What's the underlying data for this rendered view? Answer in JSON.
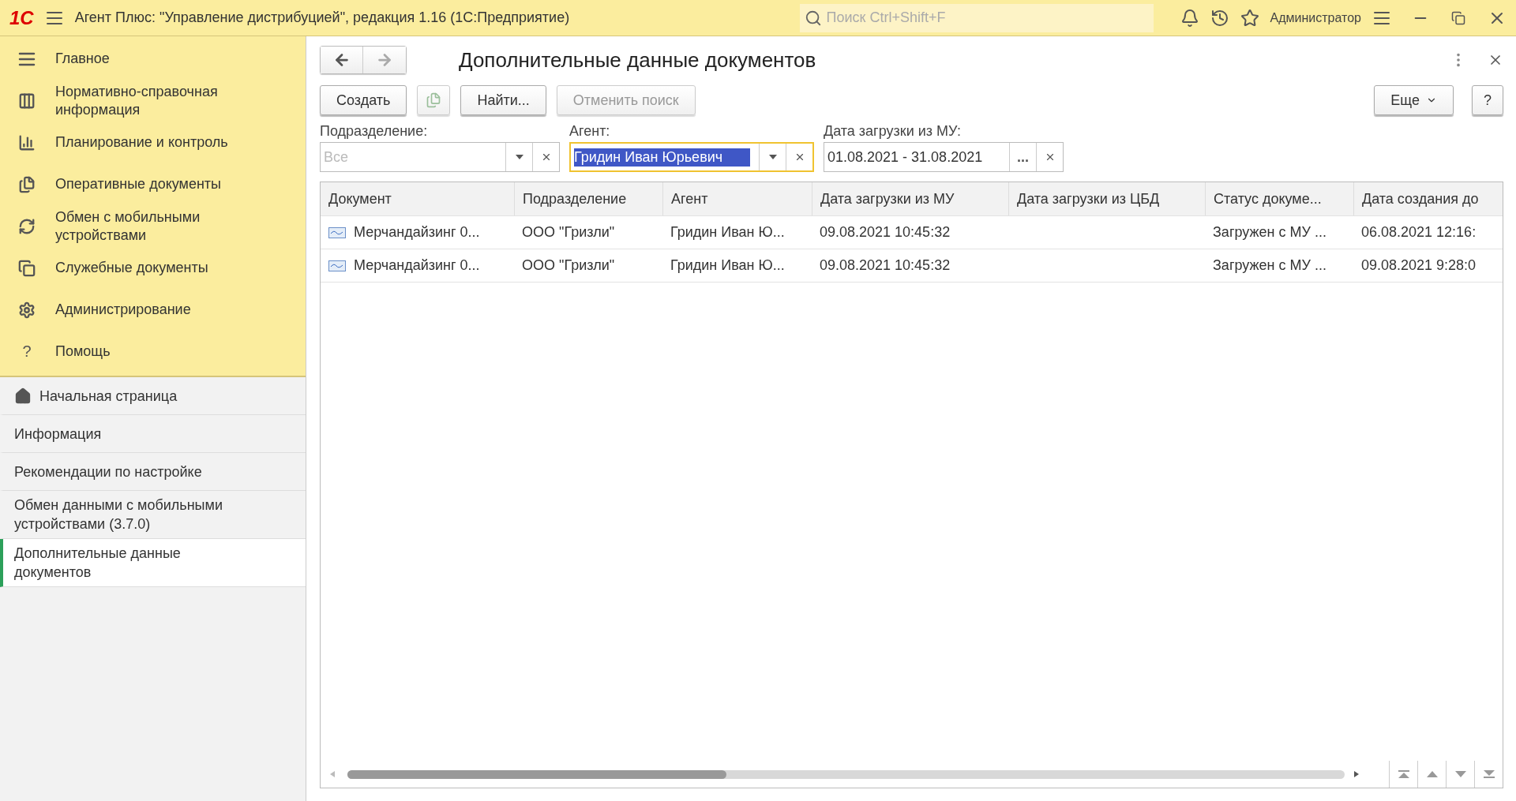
{
  "titlebar": {
    "logo": "1С",
    "title": "Агент Плюс: \"Управление дистрибуцией\", редакция 1.16  (1С:Предприятие)",
    "search_placeholder": "Поиск Ctrl+Shift+F",
    "user": "Администратор"
  },
  "sections": [
    {
      "label": "Главное"
    },
    {
      "label": "Нормативно-справочная информация"
    },
    {
      "label": "Планирование и контроль"
    },
    {
      "label": "Оперативные документы"
    },
    {
      "label": "Обмен с мобильными устройствами"
    },
    {
      "label": "Служебные документы"
    },
    {
      "label": "Администрирование"
    },
    {
      "label": "Помощь"
    }
  ],
  "help_glyph": "?",
  "open_pages": [
    {
      "label": "Начальная страница",
      "home": true,
      "selected": false
    },
    {
      "label": "Информация",
      "home": false,
      "selected": false
    },
    {
      "label": "Рекомендации по настройке",
      "home": false,
      "selected": false
    },
    {
      "label": "Обмен данными с мобильными устройствами (3.7.0)",
      "home": false,
      "selected": false
    },
    {
      "label": "Дополнительные данные документов",
      "home": false,
      "selected": true
    }
  ],
  "form": {
    "title": "Дополнительные данные документов",
    "buttons": [
      {
        "label": "Создать",
        "disabled": false
      },
      {
        "label": "Найти...",
        "disabled": false
      },
      {
        "label": "Отменить поиск",
        "disabled": true
      }
    ],
    "more": "Еще",
    "help": "?",
    "filters": [
      {
        "label": "Подразделение:",
        "placeholder": "Все",
        "kind": "select",
        "focused": false
      },
      {
        "label": "Агент:",
        "value": "Гридин Иван Юрьевич",
        "kind": "select",
        "focused": true
      },
      {
        "label": "Дата загрузки из МУ:",
        "value": "01.08.2021 - 31.08.2021",
        "kind": "period",
        "focused": false,
        "dots": "..."
      }
    ],
    "table": {
      "columns": [
        "Документ",
        "Подразделение",
        "Агент",
        "Дата загрузки из МУ",
        "Дата загрузки из ЦБД",
        "Статус докуме...",
        "Дата создания до"
      ],
      "rows": [
        [
          "Мерчандайзинг 0...",
          "ООО \"Гризли\"",
          "Гридин Иван Ю...",
          "09.08.2021 10:45:32",
          "",
          "Загружен с МУ ...",
          "06.08.2021 12:16:"
        ],
        [
          "Мерчандайзинг 0...",
          "ООО \"Гризли\"",
          "Гридин Иван Ю...",
          "09.08.2021 10:45:32",
          "",
          "Загружен с МУ ...",
          "09.08.2021 9:28:0"
        ]
      ]
    }
  }
}
